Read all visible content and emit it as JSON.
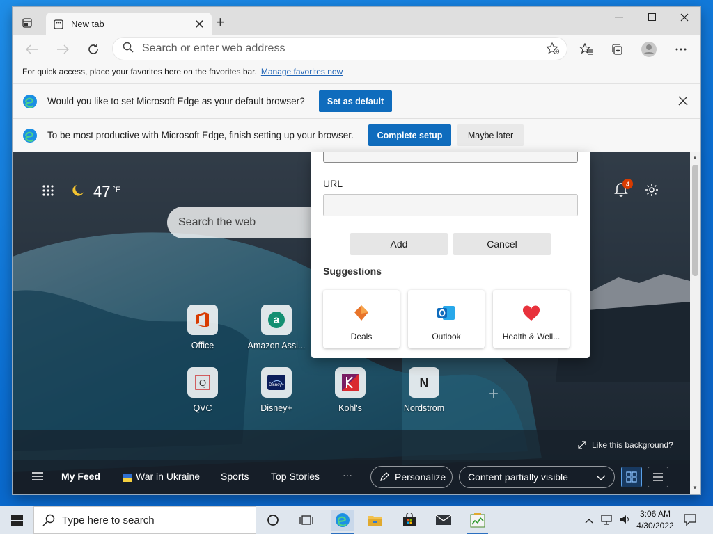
{
  "browser": {
    "tab_title": "New tab",
    "address_placeholder": "Search or enter web address",
    "favorites_bar": {
      "message": "For quick access, place your favorites here on the favorites bar.",
      "link": "Manage favorites now"
    },
    "default_banner": {
      "message": "Would you like to set Microsoft Edge as your default browser?",
      "button": "Set as default"
    },
    "setup_banner": {
      "message": "To be most productive with Microsoft Edge, finish setting up your browser.",
      "primary": "Complete setup",
      "secondary": "Maybe later"
    }
  },
  "ntp": {
    "weather": {
      "temp": "47",
      "unit": "°F"
    },
    "search_placeholder": "Search the web",
    "notification_count": "4",
    "quick_links": [
      {
        "label": "Office"
      },
      {
        "label": "Amazon Assi..."
      },
      {
        "label": "QVC"
      },
      {
        "label": "Disney+"
      },
      {
        "label": "Kohl's"
      },
      {
        "label": "Nordstrom"
      }
    ],
    "like_background": "Like this background?",
    "feed": {
      "my_feed": "My Feed",
      "items": [
        "War in Ukraine",
        "Sports",
        "Top Stories"
      ],
      "more": "···",
      "personalize": "Personalize",
      "content_visibility": "Content partially visible"
    }
  },
  "dialog": {
    "url_label": "URL",
    "add": "Add",
    "cancel": "Cancel",
    "suggestions_title": "Suggestions",
    "suggestions": [
      {
        "label": "Deals"
      },
      {
        "label": "Outlook"
      },
      {
        "label": "Health & Well..."
      }
    ]
  },
  "taskbar": {
    "search_placeholder": "Type here to search",
    "time": "3:06 AM",
    "date": "4/30/2022"
  },
  "colors": {
    "accent": "#0f6cbd",
    "notification_badge": "#d83b01"
  }
}
